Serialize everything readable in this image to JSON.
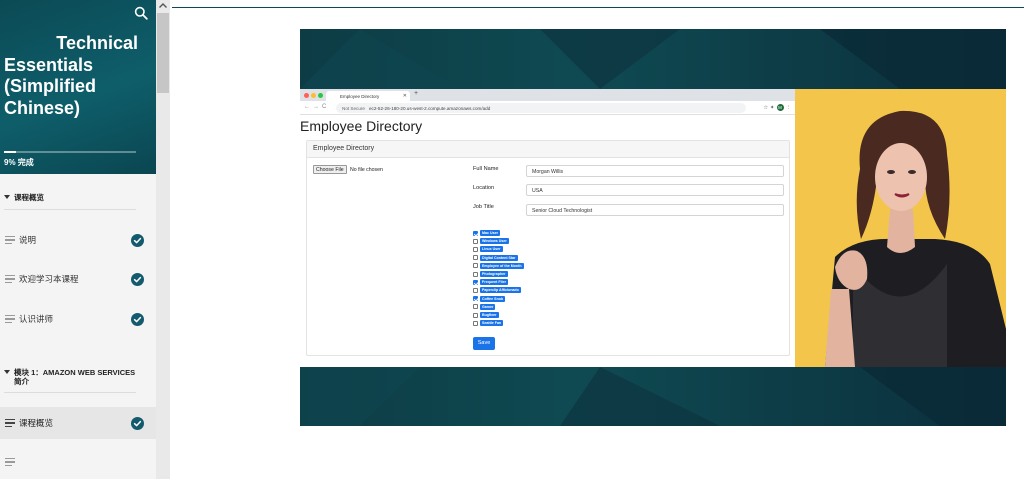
{
  "sidebar": {
    "title_line1": "Technical",
    "title_rest": "Essentials (Simplified Chinese)",
    "progress_label": "9% 完成",
    "progress_fraction": 0.09,
    "section1": "课程概览",
    "items1": [
      {
        "label": "说明",
        "done": true
      },
      {
        "label": "欢迎学习本课程",
        "done": true
      },
      {
        "label": "认识讲师",
        "done": true
      }
    ],
    "section2": "模块 1：AMAZON WEB SERVICES 简介",
    "items2": [
      {
        "label": "课程概览",
        "done": true,
        "active": true
      },
      {
        "label": "",
        "done": false
      }
    ]
  },
  "browser": {
    "tab_title": "Employee Directory",
    "url_prefix": "Not Secure",
    "url": "ec2-52-26-180-20.us-west-2.compute.amazonaws.com/add",
    "avatar_letter": "M"
  },
  "page": {
    "heading": "Employee Directory",
    "card_heading": "Employee Directory",
    "choose_file": "Choose File",
    "no_file": "No file chosen",
    "fields": [
      {
        "label": "Full Name",
        "value": "Morgan Willis"
      },
      {
        "label": "Location",
        "value": "USA"
      },
      {
        "label": "Job Title",
        "value": "Senior Cloud Technologist"
      }
    ],
    "badges": [
      {
        "label": "Mac User",
        "checked": true
      },
      {
        "label": "Windows User",
        "checked": false
      },
      {
        "label": "Linux User",
        "checked": false
      },
      {
        "label": "Digital Content Star",
        "checked": false
      },
      {
        "label": "Employee of the Month",
        "checked": false
      },
      {
        "label": "Photographer",
        "checked": false
      },
      {
        "label": "Frequent Flier",
        "checked": true
      },
      {
        "label": "Paperclip Afficionado",
        "checked": false
      },
      {
        "label": "Coffee Snob",
        "checked": true
      },
      {
        "label": "Gamer",
        "checked": false
      },
      {
        "label": "Bugfixer",
        "checked": false
      },
      {
        "label": "Seattle Fan",
        "checked": false
      }
    ],
    "save_label": "Save"
  },
  "colors": {
    "brand_teal": "#0b4a55",
    "check_blue": "#145a6e",
    "badge_blue": "#1a73e8",
    "presenter_bg": "#f3c64b"
  }
}
